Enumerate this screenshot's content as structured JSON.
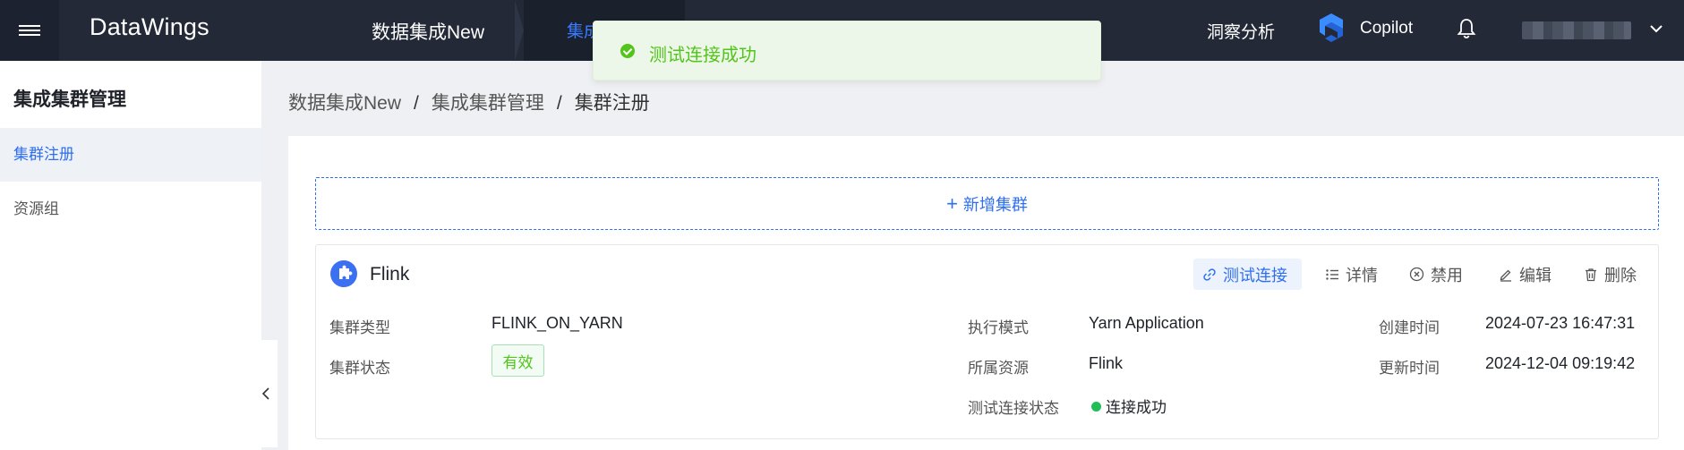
{
  "app": {
    "brand": "DataWings"
  },
  "topnav": {
    "project": "数据集成New",
    "active_tab": "集成集群",
    "hidden_tab_1": "",
    "hidden_tab_2": "",
    "hidden_tab_3": "",
    "insight": "洞察分析",
    "copilot": "Copilot"
  },
  "toast": {
    "message": "测试连接成功"
  },
  "sidebar": {
    "title": "集成集群管理",
    "items": [
      {
        "label": "集群注册",
        "active": true
      },
      {
        "label": "资源组",
        "active": false
      }
    ]
  },
  "breadcrumb": [
    "数据集成New",
    "集成集群管理",
    "集群注册"
  ],
  "main": {
    "add_button": "新增集群",
    "cluster": {
      "name": "Flink",
      "actions": {
        "test": "测试连接",
        "detail": "详情",
        "disable": "禁用",
        "edit": "编辑",
        "delete": "删除"
      },
      "fields": {
        "type_label": "集群类型",
        "type_value": "FLINK_ON_YARN",
        "status_label": "集群状态",
        "status_value": "有效",
        "mode_label": "执行模式",
        "mode_value": "Yarn Application",
        "resource_label": "所属资源",
        "resource_value": "Flink",
        "test_status_label": "测试连接状态",
        "test_status_value": "连接成功",
        "created_label": "创建时间",
        "created_value": "2024-07-23 16:47:31",
        "updated_label": "更新时间",
        "updated_value": "2024-12-04 09:19:42"
      }
    }
  },
  "colors": {
    "topbar_bg": "#232937",
    "accent": "#2f6fed",
    "success": "#52c41a",
    "page_bg": "#eef0f3"
  }
}
